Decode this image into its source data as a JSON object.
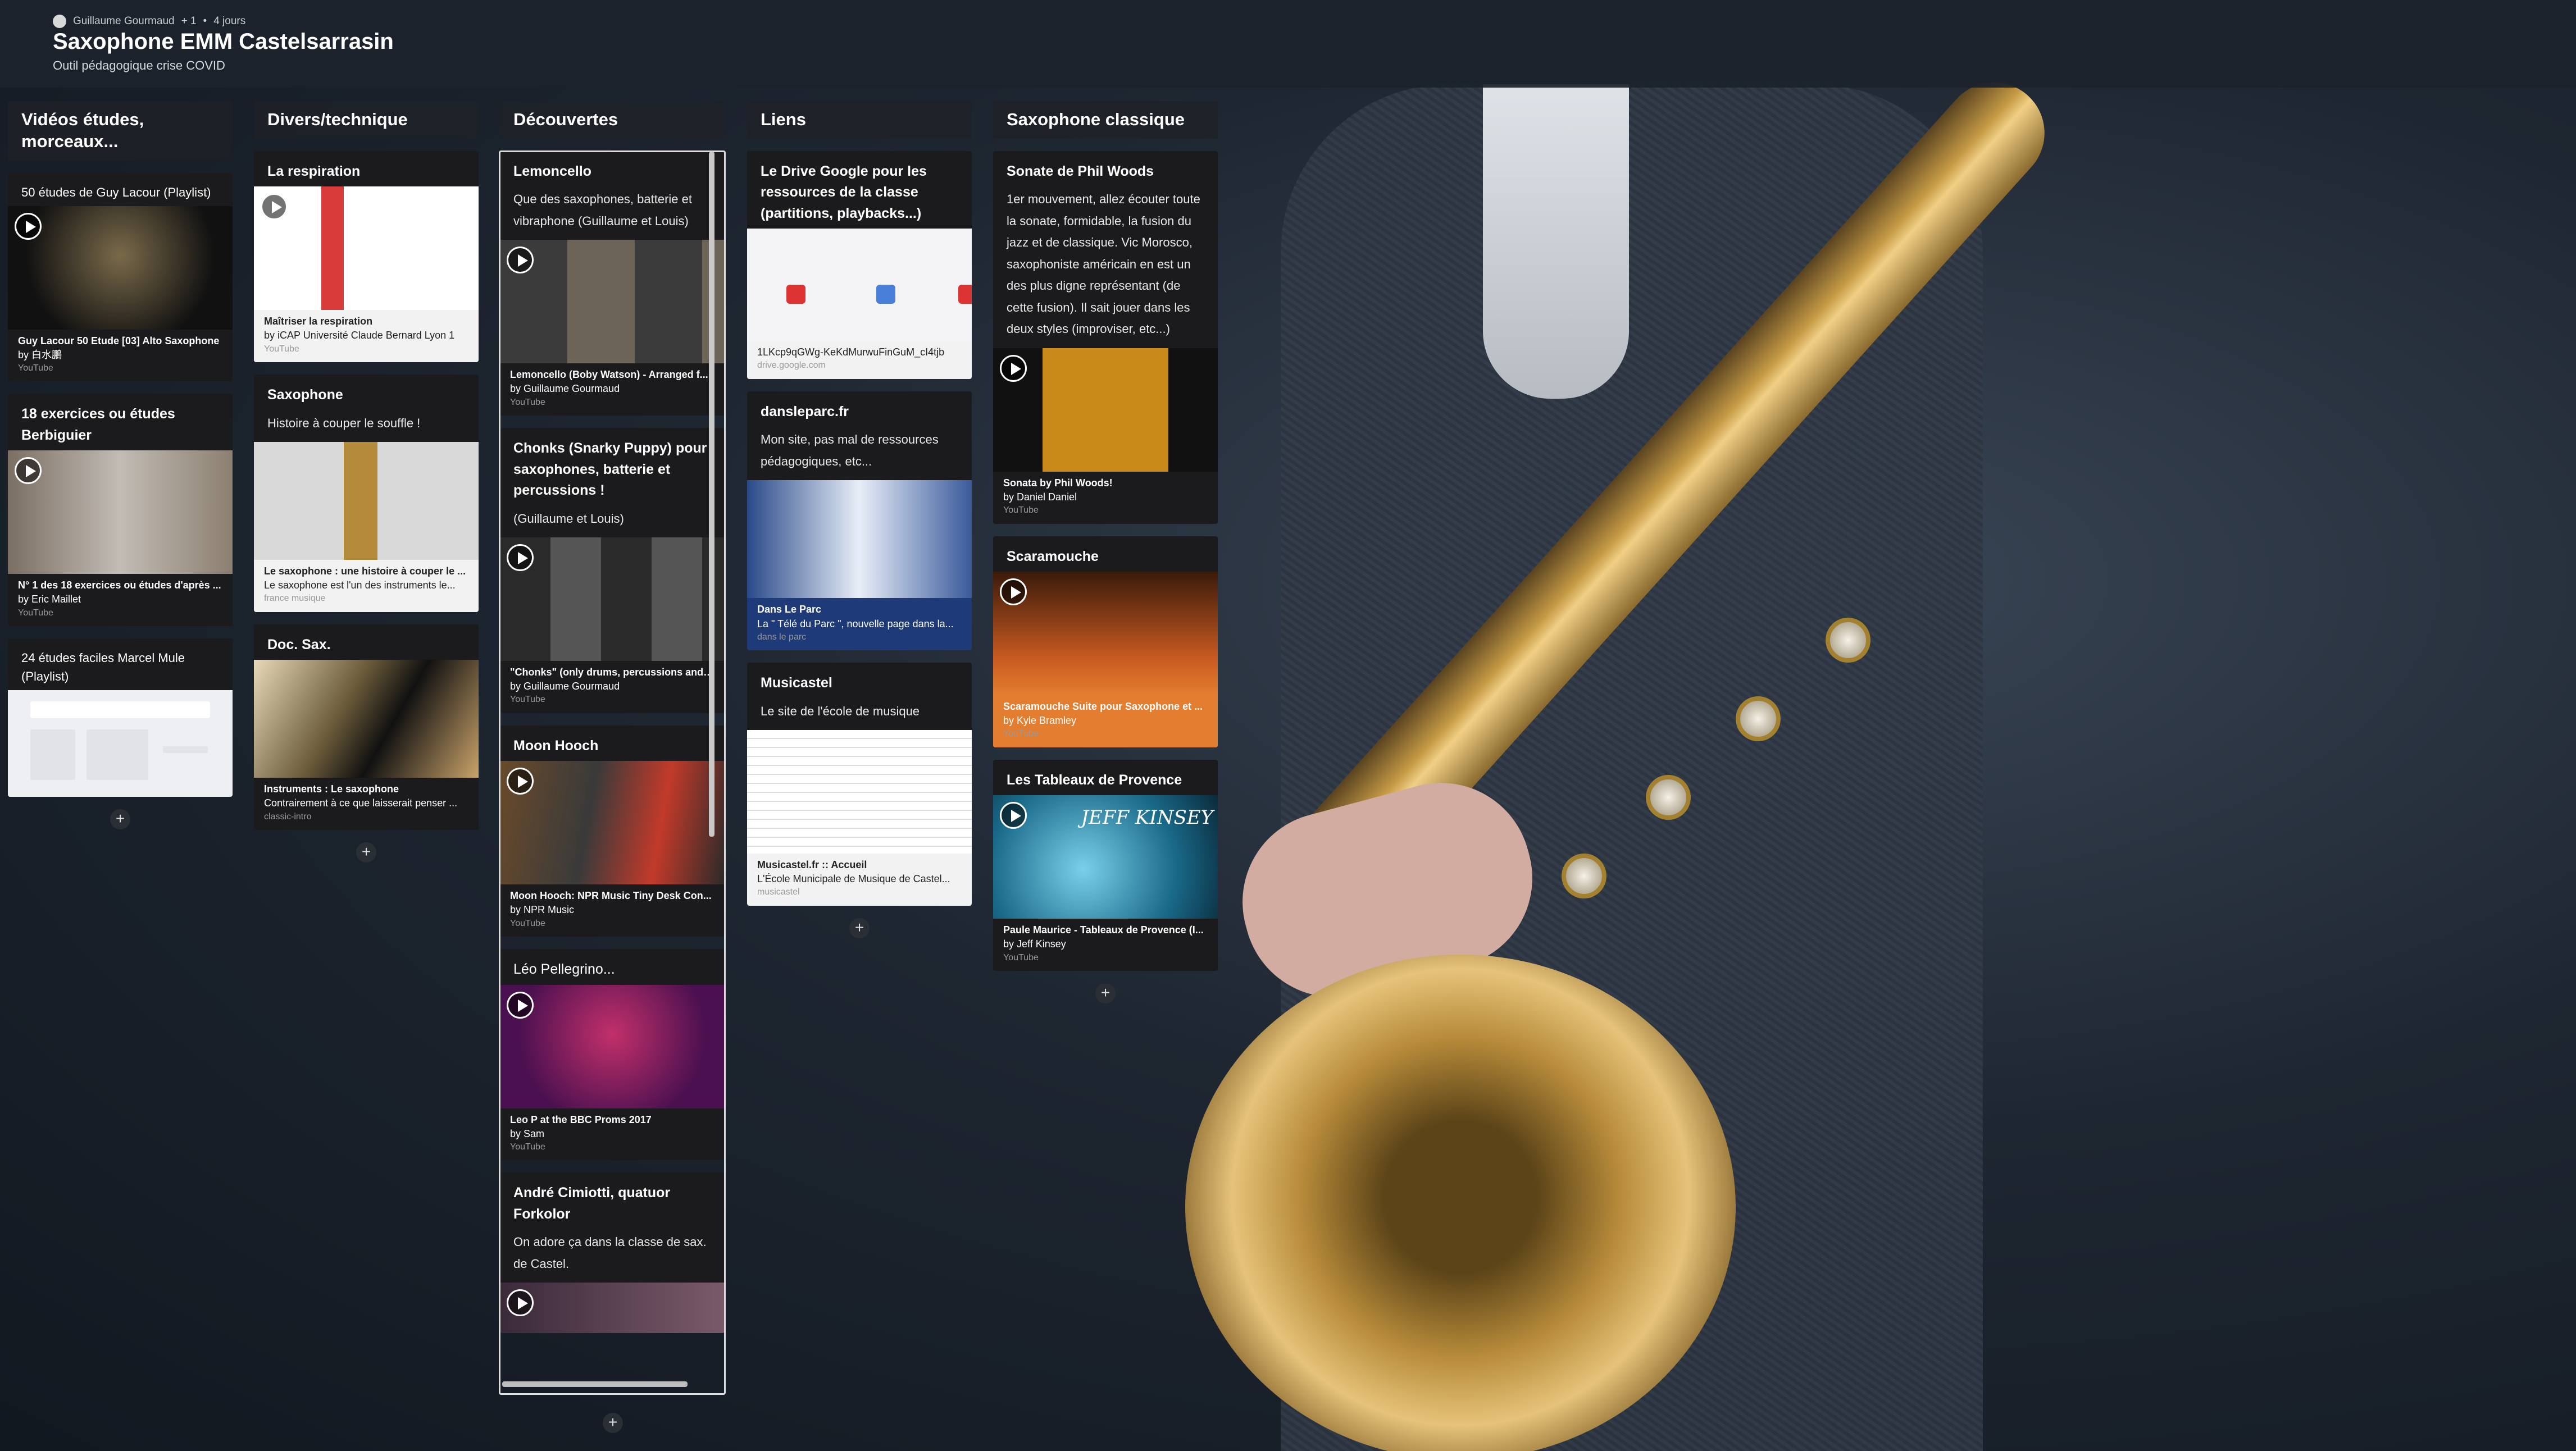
{
  "header": {
    "author": "Guillaume Gourmaud",
    "plus": "+ 1",
    "age": "4 jours",
    "title": "Saxophone EMM Castelsarrasin",
    "subtitle": "Outil pédagogique crise COVID"
  },
  "columns": {
    "c1": {
      "title": "Vidéos études, morceaux...",
      "cards": [
        {
          "title": "50 études de Guy Lacour (Playlist)",
          "cap1": "Guy Lacour 50 Etude [03] Alto Saxophone",
          "cap2": "by 白水鵬",
          "src": "YouTube"
        },
        {
          "title": "18 exercices ou études Berbiguier",
          "cap1": "N° 1 des 18 exercices ou études d'après ...",
          "cap2": "by Eric Maillet",
          "src": "YouTube"
        },
        {
          "title": "24 études faciles Marcel Mule (Playlist)"
        }
      ]
    },
    "c2": {
      "title": "Divers/technique",
      "cards": [
        {
          "title": "La respiration",
          "cap1": "Maîtriser la respiration",
          "cap2": "by iCAP Université Claude Bernard Lyon 1",
          "src": "YouTube"
        },
        {
          "title": "Saxophone",
          "body": "Histoire à couper le souffle !",
          "cap1": "Le saxophone : une histoire à couper le ...",
          "cap2": "Le saxophone est l'un des instruments le...",
          "src": "france musique"
        },
        {
          "title": "Doc. Sax.",
          "cap1": "Instruments : Le saxophone",
          "cap2": "Contrairement à ce que laisserait penser ...",
          "src": "classic-intro"
        }
      ]
    },
    "c3": {
      "title": "Découvertes",
      "cards": [
        {
          "title": "Lemoncello",
          "body": "Que des saxophones, batterie et vibraphone (Guillaume et Louis)",
          "cap1": "Lemoncello (Boby Watson) - Arranged f...",
          "cap2": "by Guillaume Gourmaud",
          "src": "YouTube"
        },
        {
          "title": "Chonks (Snarky Puppy) pour saxophones, batterie et percussions !",
          "body": "(Guillaume et Louis)",
          "cap1": "\"Chonks\" (only drums, percussions and ...",
          "cap2": "by Guillaume Gourmaud",
          "src": "YouTube"
        },
        {
          "title": "Moon Hooch",
          "cap1": "Moon Hooch: NPR Music Tiny Desk Con...",
          "cap2": "by NPR Music",
          "src": "YouTube"
        },
        {
          "title": "Léo Pellegrino...",
          "cap1": "Leo P at the BBC Proms 2017",
          "cap2": "by Sam",
          "src": "YouTube"
        },
        {
          "title": "André Cimiotti, quatuor Forkolor",
          "body": "On adore ça dans la classe de sax. de Castel."
        }
      ]
    },
    "c4": {
      "title": "Liens",
      "cards": [
        {
          "title": "Le Drive Google pour les ressources de la classe (partitions, playbacks...)",
          "cap1": "1LKcp9qGWg-KeKdMurwuFinGuM_cI4tjb",
          "src": "drive.google.com"
        },
        {
          "title": "dansleparc.fr",
          "body": "Mon site, pas mal de ressources pédagogiques, etc...",
          "cap1": "Dans Le Parc",
          "cap2": "La \" Télé du Parc \", nouvelle page dans la...",
          "src": "dans le parc"
        },
        {
          "title": "Musicastel",
          "body": "Le site de l'école de musique",
          "cap1": "Musicastel.fr :: Accueil",
          "cap2": "L'École Municipale de Musique de Castel...",
          "src": "musicastel"
        }
      ]
    },
    "c5": {
      "title": "Saxophone classique",
      "cards": [
        {
          "title": "Sonate de Phil Woods",
          "body": "1er mouvement, allez écouter toute la sonate, formidable, la fusion du jazz et de classique. Vic Morosco, saxophoniste américain en est un des plus digne représentant (de cette fusion). Il sait jouer dans les deux styles (improviser, etc...)",
          "cap1": "Sonata by Phil Woods!",
          "cap2": "by Daniel Daniel",
          "src": "YouTube"
        },
        {
          "title": "Scaramouche",
          "cap1": "Scaramouche Suite pour Saxophone et ...",
          "cap2": "by Kyle Bramley",
          "src": "YouTube"
        },
        {
          "title": "Les Tableaux de Provence",
          "cap1": "Paule Maurice - Tableaux de Provence (I...",
          "cap2": "by Jeff Kinsey",
          "src": "YouTube",
          "thumbtext": "JEFF KINSEY"
        }
      ]
    }
  },
  "add_label": "+",
  "colors": {
    "header_bg": "#1c222c",
    "card_bg": "#1b1b1d",
    "orange": "#e37d30"
  }
}
